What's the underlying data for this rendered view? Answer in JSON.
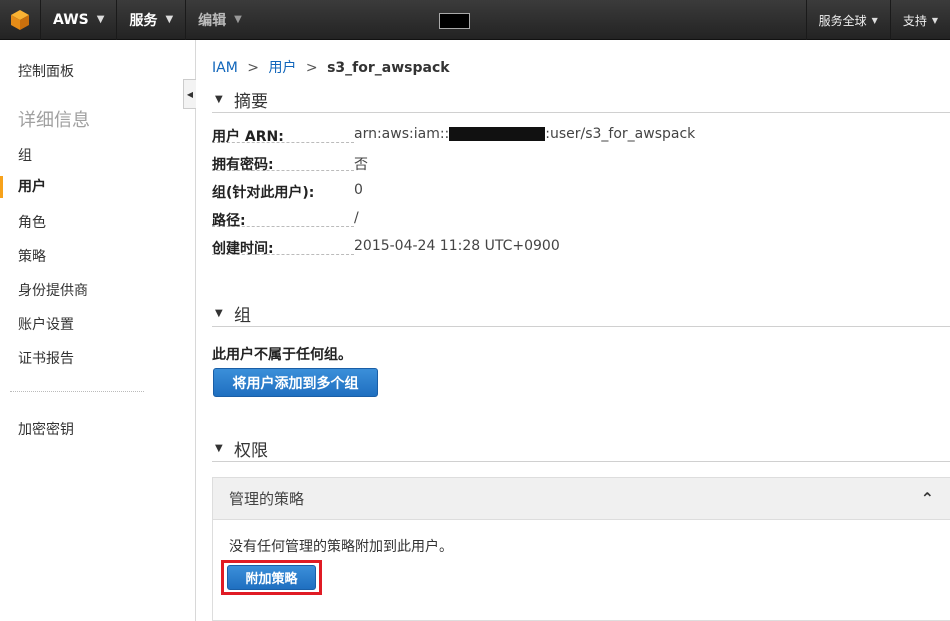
{
  "topbar": {
    "logo_icon": "aws-cube-icon",
    "brand_label": "AWS",
    "services_label": "服务",
    "edit_label": "编辑",
    "region_label": "服务全球",
    "support_label": "支持"
  },
  "sidebar": {
    "dashboard_label": "控制面板",
    "details_heading": "详细信息",
    "items": [
      {
        "label": "组"
      },
      {
        "label": "用户"
      },
      {
        "label": "角色"
      },
      {
        "label": "策略"
      },
      {
        "label": "身份提供商"
      },
      {
        "label": "账户设置"
      },
      {
        "label": "证书报告"
      }
    ],
    "encryption_label": "加密密钥"
  },
  "breadcrumb": {
    "root": "IAM",
    "sep1": ">",
    "users": "用户",
    "sep2": ">",
    "current": "s3_for_awspack"
  },
  "summary": {
    "title": "摘要",
    "rows": [
      {
        "label": "用户 ARN:",
        "value_prefix": "arn:aws:iam::",
        "value_suffix": ":user/s3_for_awspack"
      },
      {
        "label": "拥有密码:",
        "value": "否"
      },
      {
        "label": "组(针对此用户):",
        "value": "0"
      },
      {
        "label": "路径:",
        "value": "/"
      },
      {
        "label": "创建时间:",
        "value": "2015-04-24 11:28 UTC+0900"
      }
    ]
  },
  "groups": {
    "title": "组",
    "note": "此用户不属于任何组。",
    "add_button": "将用户添加到多个组"
  },
  "permissions": {
    "title": "权限",
    "managed_title": "管理的策略",
    "managed_note": "没有任何管理的策略附加到此用户。",
    "attach_button": "附加策略"
  },
  "colors": {
    "accent_orange": "#f7a21b",
    "link_blue": "#1166bb",
    "button_blue": "#1f6fc0",
    "highlight_red": "#e01b24"
  }
}
